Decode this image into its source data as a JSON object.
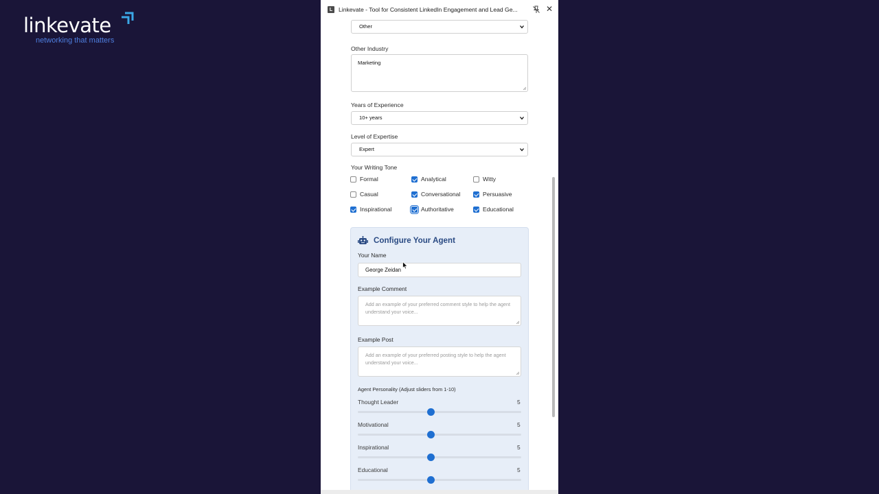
{
  "brand": {
    "name": "linkevate",
    "tagline": "networking that matters",
    "accent": "#3ba7e6",
    "tagline_color": "#4f7fe0",
    "background": "#1a1538"
  },
  "window": {
    "favicon_letter": "L",
    "title": "Linkevate - Tool for Consistent LinkedIn Engagement and Lead Ge...",
    "pin_icon": "pin-off-icon",
    "close_icon": "close-icon",
    "close_glyph": "✕"
  },
  "form": {
    "industry_select_value": "Other",
    "other_industry_label": "Other Industry",
    "other_industry_value": "Marketing",
    "years_label": "Years of Experience",
    "years_value": "10+ years",
    "expertise_label": "Level of Expertise",
    "expertise_value": "Expert",
    "tone_label": "Your Writing Tone",
    "tones": [
      {
        "label": "Formal",
        "checked": false
      },
      {
        "label": "Analytical",
        "checked": true
      },
      {
        "label": "Witty",
        "checked": false
      },
      {
        "label": "Casual",
        "checked": false
      },
      {
        "label": "Conversational",
        "checked": true
      },
      {
        "label": "Persuasive",
        "checked": true
      },
      {
        "label": "Inspirational",
        "checked": true
      },
      {
        "label": "Authoritative",
        "checked": true,
        "focused": true
      },
      {
        "label": "Educational",
        "checked": true
      }
    ]
  },
  "agent": {
    "icon": "robot-icon",
    "title": "Configure Your Agent",
    "name_label": "Your Name",
    "name_value": "George Zeidan",
    "comment_label": "Example Comment",
    "comment_placeholder": "Add an example of your preferred comment style to help the agent understand your voice...",
    "post_label": "Example Post",
    "post_placeholder": "Add an example of your preferred posting style to help the agent understand your voice...",
    "personality_label": "Agent Personality (Adjust sliders from 1-10)",
    "sliders": [
      {
        "label": "Thought Leader",
        "value": "5"
      },
      {
        "label": "Motivational",
        "value": "5"
      },
      {
        "label": "Inspirational",
        "value": "5"
      },
      {
        "label": "Educational",
        "value": "5"
      }
    ],
    "slider_min": 1,
    "slider_max": 10,
    "accent": "#1f6fd1"
  }
}
